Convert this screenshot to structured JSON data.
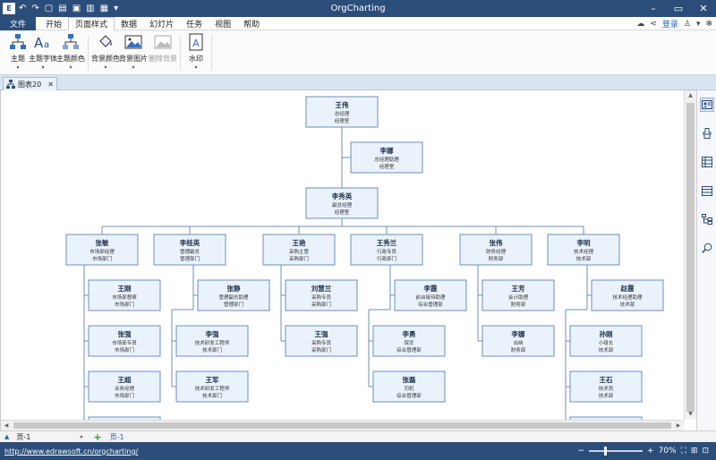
{
  "app": {
    "title": "OrgCharting"
  },
  "quick_access": [
    {
      "name": "undo-icon",
      "glyph": "↶"
    },
    {
      "name": "redo-icon",
      "glyph": "↷"
    },
    {
      "name": "new-icon",
      "glyph": "🗋"
    },
    {
      "name": "open-icon",
      "glyph": "🗁"
    },
    {
      "name": "save-icon",
      "glyph": "💾"
    },
    {
      "name": "print-icon",
      "glyph": "🖶"
    }
  ],
  "menu": {
    "file": "文件",
    "items": [
      "开始",
      "页面样式",
      "数据",
      "幻灯片",
      "任务",
      "视图",
      "帮助"
    ],
    "active": "页面样式",
    "login": "登录"
  },
  "ribbon": {
    "buttons": [
      {
        "id": "theme",
        "label": "主题",
        "icon": "theme-icon"
      },
      {
        "id": "theme-font",
        "label": "主题字体",
        "icon": "font-icon"
      },
      {
        "id": "theme-color",
        "label": "主题颜色",
        "icon": "color-icon"
      },
      {
        "id": "bg-color",
        "label": "背景颜色",
        "icon": "bucket-icon"
      },
      {
        "id": "bg-image",
        "label": "背景图片",
        "icon": "image-icon"
      },
      {
        "id": "remove-bg",
        "label": "删除背景",
        "icon": "remove-image-icon",
        "disabled": true
      },
      {
        "id": "watermark",
        "label": "水印",
        "icon": "watermark-icon"
      }
    ]
  },
  "doc_tab": {
    "label": "图表20"
  },
  "org": {
    "nodes": [
      {
        "id": "n1",
        "name": "王伟",
        "lines": [
          "总经理",
          "经理室"
        ]
      },
      {
        "id": "n2",
        "name": "李娜",
        "lines": [
          "总经理助理",
          "经理室"
        ]
      },
      {
        "id": "n3",
        "name": "李秀英",
        "lines": [
          "副总经理",
          "经理室"
        ]
      },
      {
        "id": "d1",
        "name": "张敏",
        "lines": [
          "市场部经理",
          "市场部门"
        ]
      },
      {
        "id": "d2",
        "name": "李桂英",
        "lines": [
          "管理副总",
          "管理部门"
        ]
      },
      {
        "id": "d3",
        "name": "王艳",
        "lines": [
          "采购主管",
          "采购部门"
        ]
      },
      {
        "id": "d4",
        "name": "王秀兰",
        "lines": [
          "行政专员",
          "行政部门"
        ]
      },
      {
        "id": "d5",
        "name": "张伟",
        "lines": [
          "财务经理",
          "财务部"
        ]
      },
      {
        "id": "d6",
        "name": "李明",
        "lines": [
          "技术经理",
          "技术部"
        ]
      },
      {
        "id": "c11",
        "name": "王刚",
        "lines": [
          "市场部督察",
          "市场部门"
        ]
      },
      {
        "id": "c12",
        "name": "张强",
        "lines": [
          "市场部专员",
          "市场部门"
        ]
      },
      {
        "id": "c13",
        "name": "王超",
        "lines": [
          "业务经理",
          "市场部门"
        ]
      },
      {
        "id": "c21",
        "name": "张静",
        "lines": [
          "管理副总助理",
          "管理部门"
        ]
      },
      {
        "id": "c22",
        "name": "李强",
        "lines": [
          "技术研发工程师",
          "技术部门"
        ]
      },
      {
        "id": "c23",
        "name": "王军",
        "lines": [
          "技术研发工程师",
          "技术部门"
        ]
      },
      {
        "id": "c31",
        "name": "刘慧兰",
        "lines": [
          "采购专员",
          "采购部门"
        ]
      },
      {
        "id": "c32",
        "name": "王强",
        "lines": [
          "采购专员",
          "采购部门"
        ]
      },
      {
        "id": "c41",
        "name": "李霞",
        "lines": [
          "前台接待助理",
          "综合管理部"
        ]
      },
      {
        "id": "c42",
        "name": "李勇",
        "lines": [
          "保安",
          "综合管理部"
        ]
      },
      {
        "id": "c43",
        "name": "张磊",
        "lines": [
          "司机",
          "综合管理部"
        ]
      },
      {
        "id": "c51",
        "name": "王芳",
        "lines": [
          "会计助理",
          "财务部"
        ]
      },
      {
        "id": "c52",
        "name": "李娜",
        "lines": [
          "出纳",
          "财务部"
        ]
      },
      {
        "id": "c61",
        "name": "赵霞",
        "lines": [
          "技术经理助理",
          "技术部"
        ]
      },
      {
        "id": "c62",
        "name": "孙刚",
        "lines": [
          "小组长",
          "技术部"
        ]
      },
      {
        "id": "c63",
        "name": "王石",
        "lines": [
          "技术员",
          "技术部"
        ]
      }
    ]
  },
  "page_bar": {
    "page_select": "页-1",
    "page_tab": "页-1"
  },
  "status": {
    "url": "http://www.edrawsoft.cn/orgcharting/",
    "zoom": "70%"
  }
}
